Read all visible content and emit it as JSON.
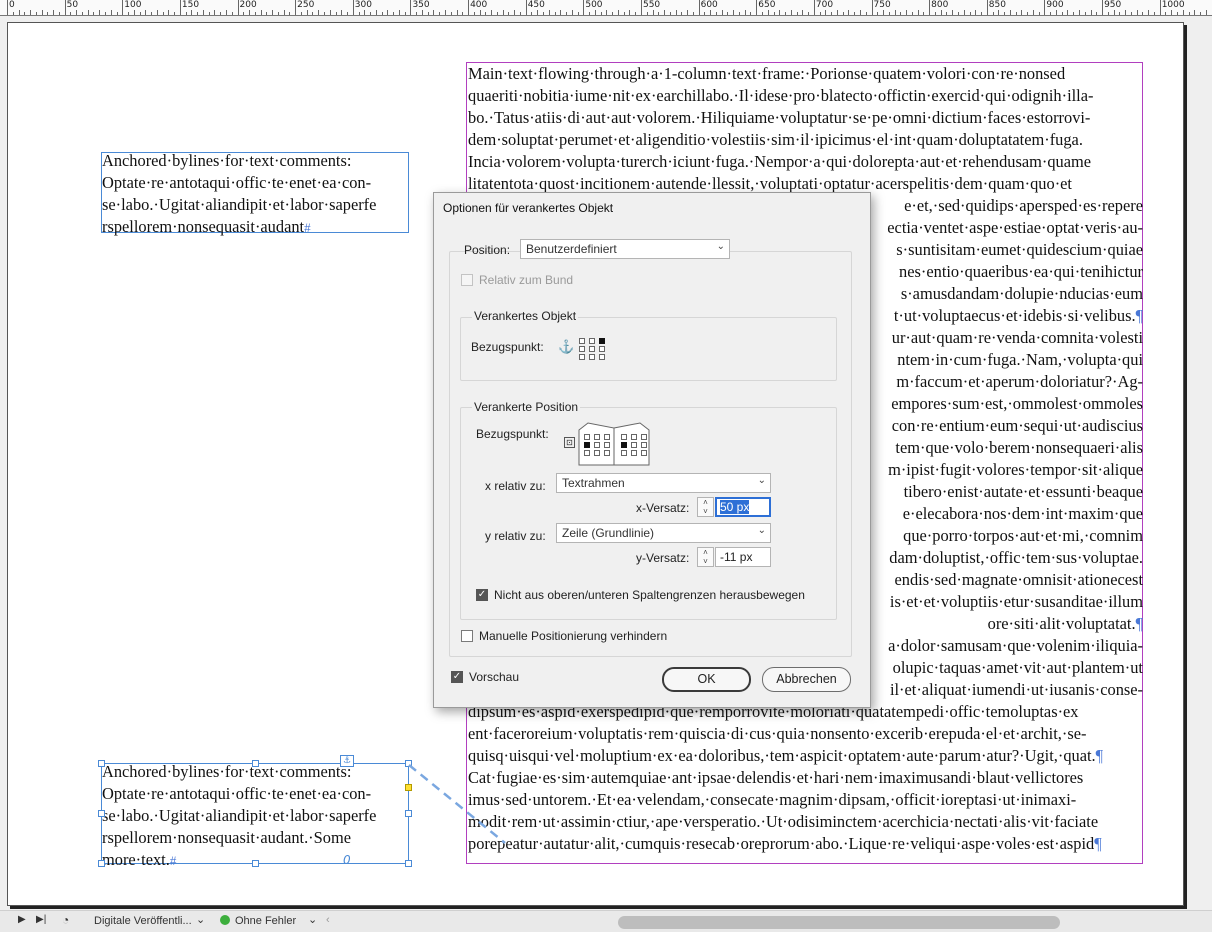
{
  "ruler": {
    "labels": [
      "0",
      "50",
      "100",
      "150",
      "200",
      "250",
      "300",
      "350",
      "400",
      "450",
      "500",
      "550",
      "600",
      "650",
      "700",
      "750",
      "800",
      "850",
      "900",
      "950",
      "1000"
    ]
  },
  "main_text": {
    "lines": [
      "Main·text·flowing·through·a·1-column·text·frame:·Porionse·quatem·volori·con·re·nonsed",
      "quaeriti·nobitia·iume·nit·ex·earchillabo.·Il·idese·pro·blatecto·offictin·exercid·qui·odignih·illa-",
      "bo.·Tatus·atiis·di·aut·aut·volorem.·Hiliquiame·voluptatur·se·pe·omni·dictium·faces·estorrovi-",
      "dem·soluptat·perumet·et·aligenditio·volestiis·sim·il·ipicimus·el·int·quam·doluptatatem·fuga.",
      "Incia·volorem·volupta·turerch·iciunt·fuga.·Nempor·a·qui·dolorepta·aut·et·rehendusam·quame",
      "litatentota·quost·incitionem·autende·llessit,·voluptati·optatur·acerspelitis·dem·quam·quo·et",
      "e·et,·sed·quidips·apersped·es·repere",
      "ectia·ventet·aspe·estiae·optat·veris·au-",
      "s·suntisitam·eumet·quidescium·quiae",
      "nes·entio·quaeribus·ea·qui·tenihictur",
      "s·amusdandam·dolupie·nducias·eum",
      "t·ut·voluptaecus·et·idebis·si·velibus.",
      "ur·aut·quam·re·venda·comnita·volesti",
      "ntem·in·cum·fuga.·Nam,·volupta·qui",
      "m·faccum·et·aperum·doloriatur?·Ag-",
      "empores·sum·est,·ommolest·ommoles",
      "con·re·entium·eum·sequi·ut·audiscius",
      "tem·que·volo·berem·nonsequaeri·alis",
      "m·ipist·fugit·volores·tempor·sit·alique",
      "tibero·enist·autate·et·essunti·beaque",
      "e·elecabora·nos·dem·int·maxim·que",
      "que·porro·torpos·aut·et·mi,·comnim",
      "dam·doluptist,·offic·tem·sus·voluptae.",
      "endis·sed·magnate·omnisit·ationecest",
      "is·et·et·voluptiis·etur·susanditae·illum",
      "ore·siti·alit·voluptatat.",
      "a·dolor·samusam·que·volenim·iliquia-",
      "olupic·taquas·amet·vit·aut·plantem·ut",
      "il·et·aliquat·iumendi·ut·iusanis·conse-",
      "dipsum·es·aspid·exerspedipid·que·remporrovite·moloriati·quatatempedi·offic·temoluptas·ex",
      "ent·faceroreium·voluptatis·rem·quiscia·di·cus·quia·nonsento·excerib·erepuda·el·et·archit,·se-",
      "quisq·uisqui·vel·moluptium·ex·ea·doloribus,·tem·aspicit·optatem·aute·parum·atur?·Ugit,·quat.",
      "Cat·fugiae·es·sim·autemquiae·ant·ipsae·delendis·et·hari·nem·imaximusandi·blaut·vellictores",
      "imus·sed·untorem.·Et·ea·velendam,·consecate·magnim·dipsam,·officit·ioreptasi·ut·inimaxi-",
      "modit·rem·ut·assimin·ctiur,·ape·versperatio.·Ut·odisiminctem·acerchicia·nectati·alis·vit·faciate",
      "porepeatur·autatur·alit,·cumquis·resecab·oreprorum·abo.·Lique·re·veliqui·aspe·voles·est·aspid"
    ]
  },
  "anchored_top": {
    "lines": [
      "Anchored·bylines·for·text·comments:",
      "Optate·re·antotaqui·offic·te·enet·ea·con-",
      "se·labo.·Ugitat·aliandipit·et·labor·saperfe",
      "rspellorem·nonsequasit·audant"
    ],
    "end_mark": "#"
  },
  "anchored_bottom": {
    "lines": [
      "Anchored·bylines·for·text·comments:",
      "Optate·re·antotaqui·offic·te·enet·ea·con-",
      "se·labo.·Ugitat·aliandipit·et·labor·saperfe",
      "rspellorem·nonsequasit·audant.·Some",
      "more·text."
    ],
    "end_mark": "#",
    "overset_mark": "0"
  },
  "dialog": {
    "title": "Optionen für verankertes Objekt",
    "position_label": "Position:",
    "position_value": "Benutzerdefiniert",
    "relative_spine_label": "Relativ zum Bund",
    "anchored_object": {
      "legend": "Verankertes Objekt",
      "ref_label": "Bezugspunkt:"
    },
    "anchored_position": {
      "legend": "Verankerte Position",
      "ref_label": "Bezugspunkt:",
      "x_rel_label": "x relativ zu:",
      "x_rel_value": "Textrahmen",
      "x_offset_label": "x-Versatz:",
      "x_offset_value": "50 px",
      "y_rel_label": "y relativ zu:",
      "y_rel_value": "Zeile (Grundlinie)",
      "y_offset_label": "y-Versatz:",
      "y_offset_value": "-11 px",
      "keep_within_label": "Nicht aus oberen/unteren Spaltengrenzen herausbewegen"
    },
    "prevent_manual_label": "Manuelle Positionierung verhindern",
    "preview_label": "Vorschau",
    "ok_label": "OK",
    "cancel_label": "Abbrechen"
  },
  "statusbar": {
    "profile": "Digitale Veröffentli...",
    "preflight": "Ohne Fehler"
  },
  "colors": {
    "frame_border": "#b13fbf",
    "anchor_frame_border": "#4a8ad6",
    "accent": "#2d6fd6",
    "preflight_ok": "#3cae3c"
  }
}
